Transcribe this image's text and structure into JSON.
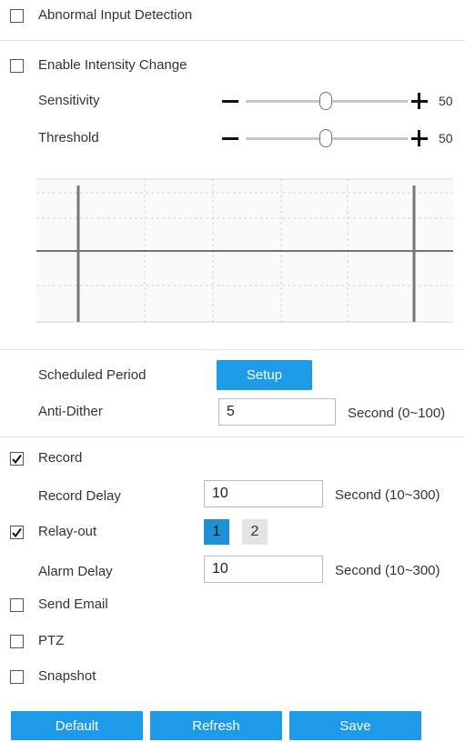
{
  "abnormal": {
    "label": "Abnormal Input Detection",
    "checked": false
  },
  "intensity": {
    "label": "Enable Intensity Change",
    "checked": false
  },
  "sensitivity": {
    "label": "Sensitivity",
    "value": "50"
  },
  "threshold": {
    "label": "Threshold",
    "value": "50"
  },
  "schedule": {
    "label": "Scheduled Period",
    "button": "Setup"
  },
  "antidither": {
    "label": "Anti-Dither",
    "value": "5",
    "unit": "Second (0~100)"
  },
  "record": {
    "label": "Record",
    "checked": true,
    "delay_label": "Record Delay",
    "delay_value": "10",
    "delay_unit": "Second (10~300)"
  },
  "relay": {
    "label": "Relay-out",
    "checked": true,
    "outputs": [
      "1",
      "2"
    ],
    "selected": "1",
    "delay_label": "Alarm Delay",
    "delay_value": "10",
    "delay_unit": "Second (10~300)"
  },
  "email": {
    "label": "Send Email",
    "checked": false
  },
  "ptz": {
    "label": "PTZ",
    "checked": false
  },
  "snapshot": {
    "label": "Snapshot",
    "checked": false
  },
  "buttons": {
    "default": "Default",
    "refresh": "Refresh",
    "save": "Save"
  },
  "colors": {
    "accent": "#1e9be8",
    "selected_output": "#1e90d6",
    "unselected_output": "#e4e4e4"
  }
}
